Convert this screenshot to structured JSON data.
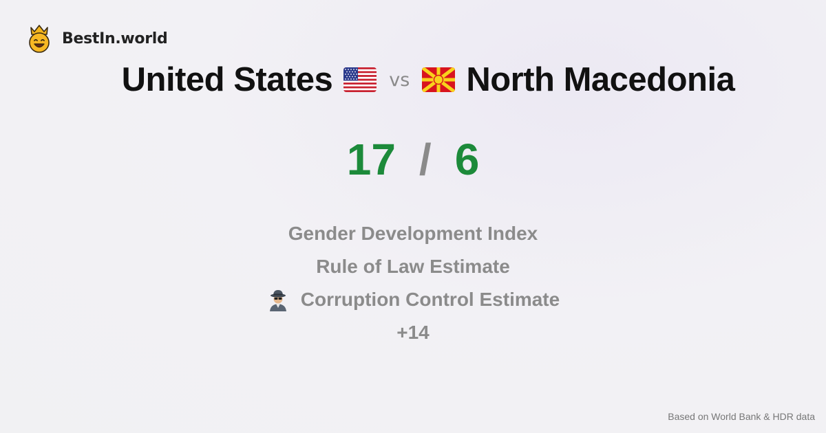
{
  "brand": {
    "name": "BestIn.world",
    "icon": "crown-smiley-icon"
  },
  "comparison": {
    "left_country": "United States",
    "left_flag": "us-flag-icon",
    "vs_label": "vs",
    "right_country": "North Macedonia",
    "right_flag": "north-macedonia-flag-icon"
  },
  "score": {
    "left": "17",
    "separator": "/",
    "right": "6"
  },
  "metrics": [
    {
      "label": "Gender Development Index",
      "icon": ""
    },
    {
      "label": "Rule of Law Estimate",
      "icon": ""
    },
    {
      "label": "Corruption Control Estimate",
      "icon": "spy-icon"
    },
    {
      "label": "+14",
      "icon": ""
    }
  ],
  "footer": {
    "source": "Based on World Bank & HDR data"
  },
  "colors": {
    "score_green": "#1c8a3a",
    "muted": "#8b8b8b"
  }
}
